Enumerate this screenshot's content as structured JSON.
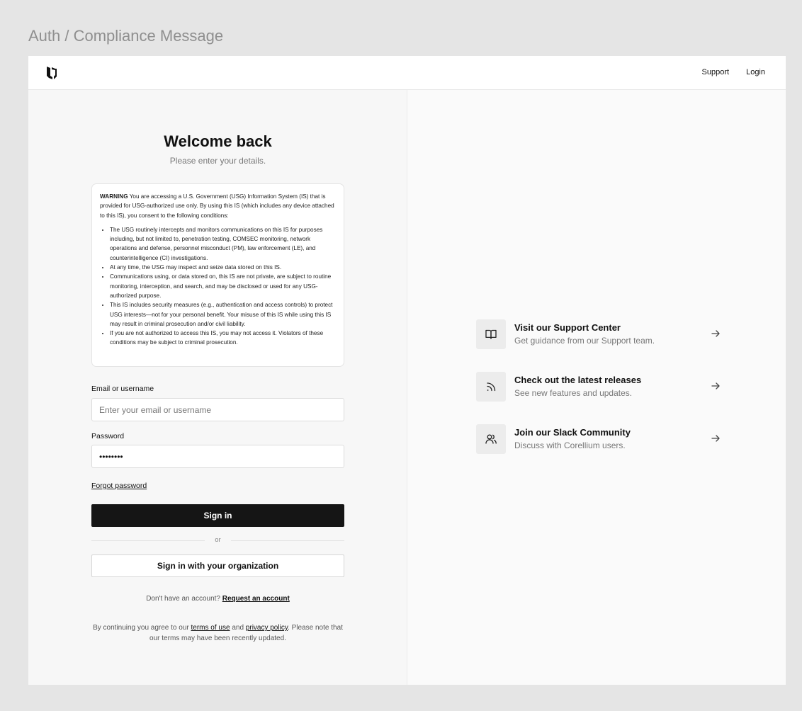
{
  "page": {
    "title": "Auth / Compliance Message"
  },
  "nav": {
    "support": "Support",
    "login": "Login"
  },
  "heading": {
    "title": "Welcome back",
    "subtitle": "Please enter your details."
  },
  "warning": {
    "label": "WARNING",
    "intro": " You are accessing a U.S. Government (USG) Information System (IS) that is provided for USG-authorized use only. By using this IS (which includes any device attached to this IS), you consent to the following conditions:",
    "items": [
      "The USG routinely intercepts and monitors communications on this IS for purposes including, but not limited to, penetration testing, COMSEC monitoring, network operations and defense, personnel misconduct (PM), law enforcement (LE), and counterintelligence (CI) investigations.",
      "At any time, the USG may inspect and seize data stored on this IS.",
      "Communications using, or data stored on, this IS are not private, are subject to routine monitoring, interception, and search, and may be disclosed or used for any USG-authorized purpose.",
      "This IS includes security measures (e.g., authentication and access controls) to protect USG interests—not for your personal benefit. Your misuse of this IS while using this IS may result in criminal prosecution and/or civil liability.",
      "If you are not authorized to access this IS, you may not access it. Violators of these conditions may be subject to criminal prosecution."
    ]
  },
  "form": {
    "email_label": "Email or username",
    "email_placeholder": "Enter your email or username",
    "email_value": "",
    "password_label": "Password",
    "password_value": "••••••••",
    "forgot": "Forgot password",
    "sign_in": "Sign in",
    "or": "or",
    "sign_in_org": "Sign in with your organization"
  },
  "account": {
    "prompt": "Don't have an account?",
    "request": "Request an account"
  },
  "legal": {
    "prefix": "By continuing you agree to our ",
    "terms": "terms of use",
    "and": " and ",
    "privacy": "privacy policy",
    "suffix": ". Please note that our terms may have been recently updated."
  },
  "links": [
    {
      "icon": "book-icon",
      "title": "Visit our Support Center",
      "desc": "Get guidance from our Support team."
    },
    {
      "icon": "rss-icon",
      "title": "Check out the latest releases",
      "desc": "See new features and updates."
    },
    {
      "icon": "users-icon",
      "title": "Join our Slack Community",
      "desc": "Discuss with Corellium users."
    }
  ]
}
